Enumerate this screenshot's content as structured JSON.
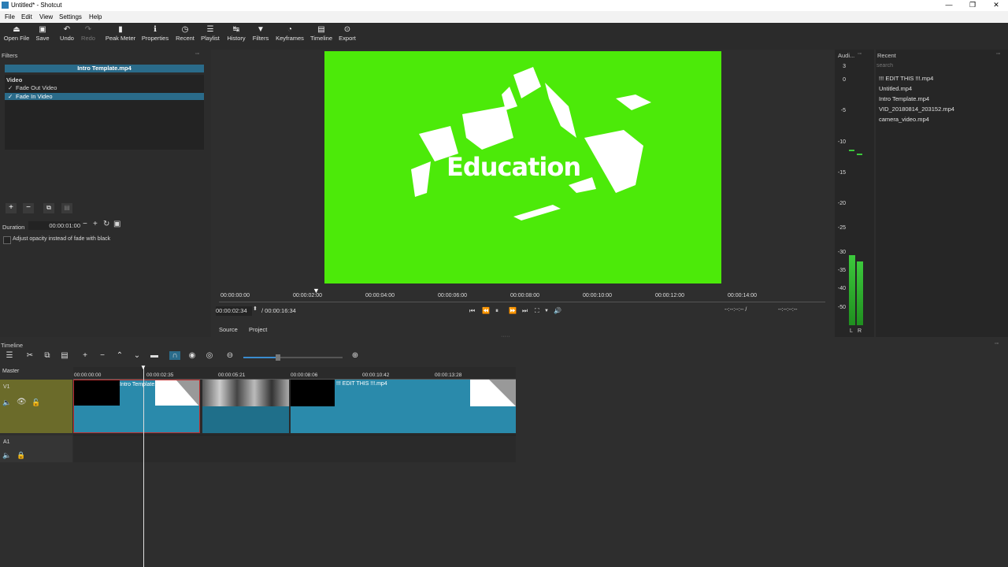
{
  "window": {
    "title": "Untitled* - Shotcut",
    "minimize": "—",
    "maximize": "❐",
    "close": "✕"
  },
  "menu": [
    "File",
    "Edit",
    "View",
    "Settings",
    "Help"
  ],
  "toolbar": [
    {
      "label": "Open File",
      "icon": "⏏"
    },
    {
      "label": "Save",
      "icon": "▣"
    },
    {
      "label": "Undo",
      "icon": "↶"
    },
    {
      "label": "Redo",
      "icon": "↷"
    },
    {
      "label": "Peak Meter",
      "icon": "▮"
    },
    {
      "label": "Properties",
      "icon": "ℹ"
    },
    {
      "label": "Recent",
      "icon": "◷"
    },
    {
      "label": "Playlist",
      "icon": "☰"
    },
    {
      "label": "History",
      "icon": "↹"
    },
    {
      "label": "Filters",
      "icon": "▼"
    },
    {
      "label": "Keyframes",
      "icon": "◔"
    },
    {
      "label": "Timeline",
      "icon": "▤"
    },
    {
      "label": "Export",
      "icon": "⊙"
    }
  ],
  "filters": {
    "panel_title": "Filters",
    "clip_name": "Intro Template.mp4",
    "section": "Video",
    "items": [
      {
        "label": "Fade Out Video",
        "checked": "✓"
      },
      {
        "label": "Fade In Video",
        "checked": "✓"
      }
    ],
    "duration_label": "Duration",
    "duration_value": "00:00:01:00",
    "opacity_option": "Adjust opacity instead of fade with black"
  },
  "preview": {
    "overlay_text": "Education",
    "ruler_ticks": [
      "00:00:00:00",
      "00:00:02:00",
      "00:00:04:00",
      "00:00:06:00",
      "00:00:08:00",
      "00:00:10:00",
      "00:00:12:00",
      "00:00:14:00"
    ],
    "current_time": "00:00:02:34",
    "total_time": "/ 00:00:16:34",
    "in_point": "--:--:--:-- /",
    "out_point": "--:--:--:--",
    "tabs": [
      "Source",
      "Project"
    ]
  },
  "audio": {
    "panel_title": "Audi...",
    "scale": [
      "3",
      "0",
      "-5",
      "-10",
      "-15",
      "-20",
      "-25",
      "-30",
      "-35",
      "-40",
      "-50"
    ],
    "channels": [
      "L",
      "R"
    ],
    "level_left": 0.52,
    "level_right": 0.47
  },
  "recent": {
    "panel_title": "Recent",
    "search_placeholder": "search",
    "items": [
      "!!! EDIT THIS !!!.mp4",
      "Untitled.mp4",
      "Intro Template.mp4",
      "VID_20180814_203152.mp4",
      "camera_video.mp4"
    ]
  },
  "timeline": {
    "panel_title": "Timeline",
    "master_label": "Master",
    "tracks": [
      {
        "name": "V1"
      },
      {
        "name": "A1"
      }
    ],
    "ticks": [
      "00:00:00:00",
      "00:00:02:35",
      "00:00:05:21",
      "00:00:08:06",
      "00:00:10:42",
      "00:00:13:28"
    ],
    "clips": [
      {
        "label": "Intro Template.mp4"
      },
      {
        "label": ""
      },
      {
        "label": "!!! EDIT THIS !!!.mp4"
      }
    ],
    "zoom_level": 0.35
  },
  "colors": {
    "preview_bg": "#4cea09",
    "selection": "#2a6b8a",
    "track_head": "#6b6b2a",
    "waveform": "#2a8aab"
  }
}
